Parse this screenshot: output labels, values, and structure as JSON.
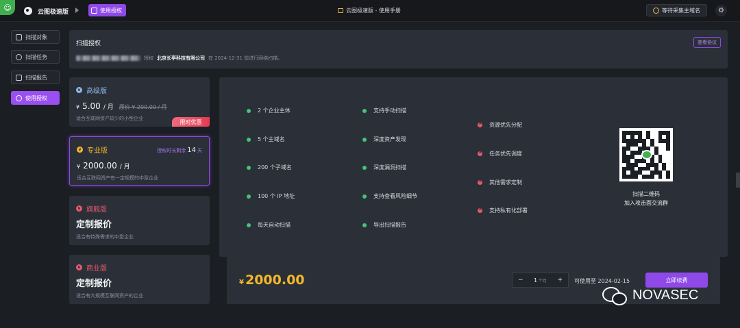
{
  "topbar": {
    "corner_logo_icon": "app-corner-logo",
    "brand_name": "云图极速版",
    "nav_chip": "使用授权",
    "manual_link": "云图极速版 - 使用手册",
    "wait_button": "等待采集主域名",
    "gear_icon": "⚙"
  },
  "sidebar": {
    "items": [
      {
        "label": "扫描对象",
        "icon": "target-icon"
      },
      {
        "label": "扫描任务",
        "icon": "clock-icon"
      },
      {
        "label": "扫描报告",
        "icon": "report-icon"
      },
      {
        "label": "使用授权",
        "icon": "user-license-icon",
        "active": true
      }
    ]
  },
  "auth": {
    "title": "扫描授权",
    "agreement_button": "查看协议",
    "grant_word": "授权",
    "company": "北京长亭科技有限公司",
    "expiry_text": "在 2024-12-31 前进行网络扫描。"
  },
  "plans": [
    {
      "name": "高级版",
      "currency": "¥",
      "price": "5.00",
      "unit": "/ 月",
      "original": "原价 ¥ 200.00 / 月",
      "desc": "适合互联网资产较少的小型企业",
      "badge": "限时优惠",
      "color": "#8fb8e8"
    },
    {
      "name": "专业版",
      "currency": "¥",
      "price": "2000.00",
      "unit": "/ 月",
      "remain_prefix": "授权时长剩余",
      "remain_days": "14",
      "remain_suffix": "天",
      "desc": "适合互联网资产有一定规模的中型企业",
      "color": "#f5b72b"
    },
    {
      "name": "旗舰版",
      "custom": "定制报价",
      "desc": "适合有特殊需求的中型企业",
      "color": "#e8596d"
    },
    {
      "name": "商业版",
      "custom": "定制报价",
      "desc": "适合有大规模互联网资产的企业",
      "color": "#e8596d"
    }
  ],
  "features": {
    "col1": [
      "2 个企业主体",
      "5 个主域名",
      "200 个子域名",
      "100 个 IP 地址",
      "每天自动扫描"
    ],
    "col2": [
      "支持手动扫描",
      "深度资产发现",
      "深度漏洞扫描",
      "支持查看风险细节",
      "导出扫描报告"
    ],
    "col3": [
      "资源优先分配",
      "任务优先调度",
      "其他需求定制",
      "支持私有化部署"
    ],
    "qr_caption_1": "扫描二维码",
    "qr_caption_2": "加入攻击面交流群"
  },
  "checkout": {
    "currency": "¥",
    "total": "2000.00",
    "minus": "−",
    "plus": "+",
    "qty": "1",
    "qty_unit": "个月",
    "valid_until": "可使用至 2024-02-15",
    "renew_button": "立即续费"
  },
  "watermark": {
    "text": "NOVASEC"
  }
}
